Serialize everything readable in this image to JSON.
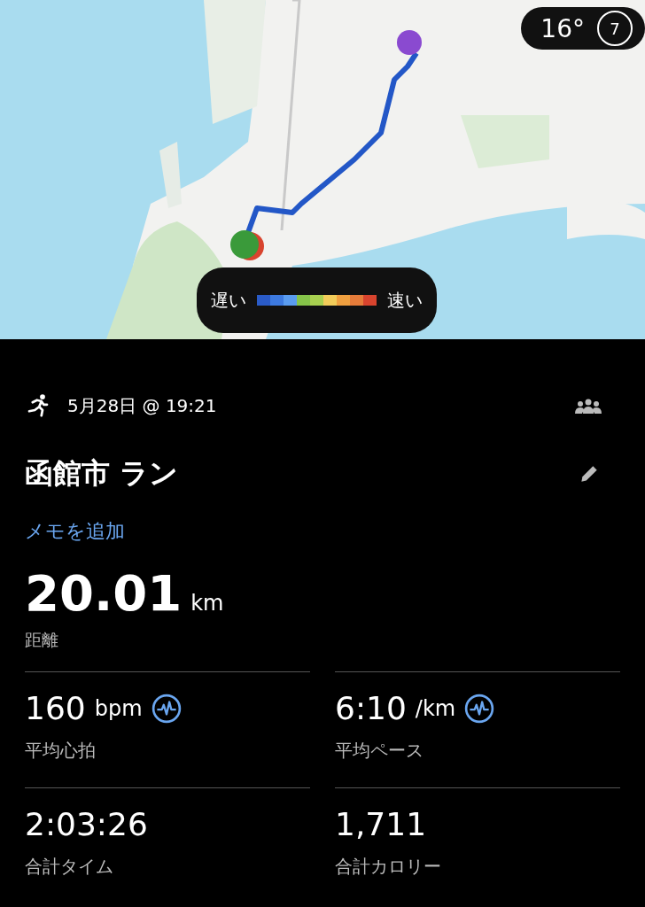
{
  "map": {
    "weather": {
      "temperature": "16°",
      "wind": "7"
    },
    "legend": {
      "slow": "遅い",
      "fast": "速い",
      "segments": [
        {
          "color": "#2a5bc8"
        },
        {
          "color": "#3d7ae0"
        },
        {
          "color": "#5a9cf0"
        },
        {
          "color": "#86c44a"
        },
        {
          "color": "#a8d050"
        },
        {
          "color": "#f2cc5a"
        },
        {
          "color": "#f0a040"
        },
        {
          "color": "#e67c3a"
        },
        {
          "color": "#d8442e"
        }
      ]
    }
  },
  "activity": {
    "date": "5月28日 @ 19:21",
    "title": "函館市 ラン",
    "memo_link": "メモを追加"
  },
  "distance": {
    "value": "20.01",
    "unit": "km",
    "label": "距離"
  },
  "stats": [
    {
      "value": "160",
      "unit": "bpm",
      "label": "平均心拍",
      "chart_link": true
    },
    {
      "value": "6:10",
      "unit": "/km",
      "label": "平均ペース",
      "chart_link": true
    },
    {
      "value": "2:03:26",
      "label": "合計タイム",
      "chart_link": false
    },
    {
      "value": "1,711",
      "label": "合計カロリー",
      "chart_link": false
    }
  ]
}
